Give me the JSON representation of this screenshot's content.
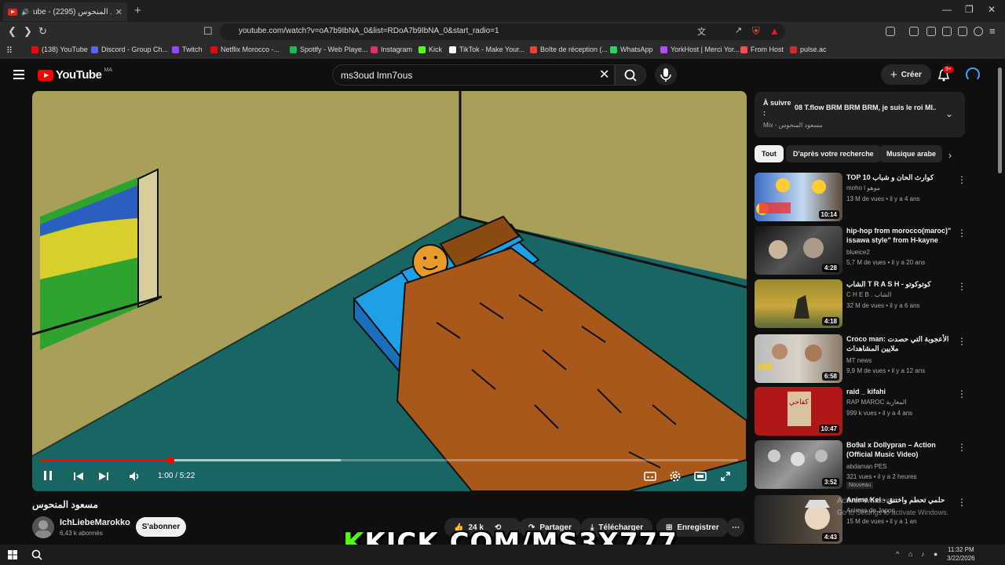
{
  "browser": {
    "tab_title": "(2295) مسعود المنحوس - YouTube",
    "tab_visible": "ube - مسعود المنحوس (2295)",
    "url": "youtube.com/watch?v=oA7b9IbNA_0&list=RDoA7b9IbNA_0&start_radio=1",
    "bookmarks": [
      {
        "label": "(138) YouTube",
        "color": "#ff0000"
      },
      {
        "label": "Discord - Group Ch...",
        "color": "#5865f2"
      },
      {
        "label": "Twitch",
        "color": "#9146ff"
      },
      {
        "label": "Netflix Morocco -...",
        "color": "#e50914"
      },
      {
        "label": "Spotify - Web Playe...",
        "color": "#1db954"
      },
      {
        "label": "Instagram",
        "color": "#e1306c"
      },
      {
        "label": "Kick",
        "color": "#53fc18"
      },
      {
        "label": "TikTok - Make Your...",
        "color": "#ffffff"
      },
      {
        "label": "Boîte de réception (...",
        "color": "#ea4335"
      },
      {
        "label": "WhatsApp",
        "color": "#25d366"
      },
      {
        "label": "YorkHost | Merci Yor...",
        "color": "#b14cff"
      },
      {
        "label": "From Host",
        "color": "#ff4d4d"
      },
      {
        "label": "pulse.ac",
        "color": "#d12a2a"
      }
    ]
  },
  "youtube": {
    "logo": "YouTube",
    "country": "MA",
    "search_query": "ms3oud lmn7ous",
    "create_label": "Créer",
    "notif_count": "9+"
  },
  "player": {
    "progress": 0.188,
    "buffered": 0.432,
    "time": "1:00 / 5:22"
  },
  "video": {
    "title": "مسعود المنحوس",
    "channel": "IchLiebeMarokko",
    "subscribers": "6,43 k abonnés",
    "subscribe_label": "S'abonner",
    "likes": "24 k",
    "share_label": "Partager",
    "download_label": "Télécharger",
    "save_label": "Enregistrer"
  },
  "sidebar": {
    "next_label": "À suivre :",
    "next_title": "08 T.flow BRM BRM BRM, je suis le roi MI...",
    "next_sub": "Mix - مسعود المنحوس",
    "chips": [
      "Tout",
      "D'après votre recherche",
      "Musique arabe"
    ],
    "recs": [
      {
        "title": "TOP 10 كوارث الحان و شباب",
        "channel": "moho l موهو",
        "meta": "13 M de vues • il y a 4 ans",
        "duration": "10:14"
      },
      {
        "title": "hip-hop from morocco(maroc)\" issawa style\" from H-kayne",
        "channel": "blueice2",
        "meta": "5,7 M de vues • il y a 20 ans",
        "duration": "4:28"
      },
      {
        "title": "الشاب T R A S H - كوتوكوتو",
        "channel": "C H E B . الشاب",
        "meta": "32 M de vues • il y a 6 ans",
        "duration": "4:18"
      },
      {
        "title": "Croco man: الأعجوبة التي حصدت ملايين المشاهدات",
        "channel": "MT news",
        "meta": "9,9 M de vues • il y a 12 ans",
        "duration": "6:58"
      },
      {
        "title": "raid _ kifahi",
        "channel": "RAP MAROC المغاربة",
        "meta": "999 k vues • il y a 4 ans",
        "duration": "10:47"
      },
      {
        "title": "Bo9al x Dollypran – Action (Official Music Video)",
        "channel": "abdaman PES",
        "meta": "321 vues • il y a 2 heures",
        "duration": "3:52",
        "badge": "Nouveau"
      },
      {
        "title": "Anime Kei - حلمي تحطم واختنق",
        "channel": "Animes de Japon",
        "meta": "15 M de vues • il y a 1 an",
        "duration": "4:43"
      }
    ]
  },
  "overlay": {
    "k": "K",
    "rest": "KICK.COM/MS3X777"
  },
  "os": {
    "activate": "Activer Windows",
    "activate_sub": "Go to Settings to activate Windows.",
    "time": "11:32 PM",
    "date": "3/22/2026"
  }
}
